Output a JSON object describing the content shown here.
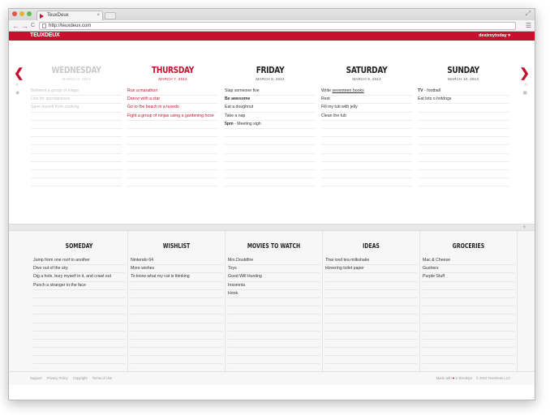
{
  "browser": {
    "tab_title": "TeuxDeux",
    "url": "http://teuxdeux.com",
    "tab_close": "×",
    "back": "←",
    "forward": "→",
    "reload": "C",
    "menu": "☰",
    "expand": "⤢"
  },
  "header": {
    "logo": "TEUXDEUX",
    "user": "destroytoday ▾"
  },
  "week": {
    "prev_arrow": "❮",
    "next_arrow": "❯",
    "days": [
      {
        "name": "WEDNESDAY",
        "date": "MARCH 6, 2013",
        "tasks": [
          "Befriend a group of ninjas",
          "Live for spontaneous",
          "Save myself from choking",
          "",
          "",
          "",
          "",
          "",
          "",
          "",
          "",
          ""
        ]
      },
      {
        "name": "THURSDAY",
        "date": "MARCH 7, 2013",
        "tasks": [
          "Run a marathon",
          "Dance with a star",
          "Go to the beach in a tuxedo",
          "Fight a group of ninjas using a gardening hose",
          "",
          "",
          "",
          "",
          "",
          "",
          "",
          ""
        ]
      },
      {
        "name": "FRIDAY",
        "date": "MARCH 8, 2013",
        "tasks": [
          "Slap someone five",
          "Be awesome",
          "Eat a doughnut",
          "Take a nap",
          "5pm - Meeting sigh",
          "",
          "",
          "",
          "",
          "",
          "",
          ""
        ]
      },
      {
        "name": "SATURDAY",
        "date": "MARCH 9, 2013",
        "tasks": [
          "Write seventeen books",
          "Rest",
          "Fill my tub with jelly",
          "Clean the tub",
          "",
          "",
          "",
          "",
          "",
          "",
          "",
          ""
        ]
      },
      {
        "name": "SUNDAY",
        "date": "MARCH 10, 2013",
        "tasks": [
          "TV - football",
          "Eat lots o hotdogs",
          "",
          "",
          "",
          "",
          "",
          "",
          "",
          "",
          "",
          ""
        ]
      }
    ]
  },
  "lists": [
    {
      "title": "SOMEDAY",
      "items": [
        "Jump from one roof to another",
        "Dive out of the sky",
        "Dig a hole, bury myself in it, and crawl out",
        "Punch a stranger in the face",
        "",
        "",
        "",
        "",
        "",
        "",
        "",
        "",
        "",
        ""
      ]
    },
    {
      "title": "WISHLIST",
      "items": [
        "Nintendo 64",
        "More wishes",
        "To know what my cat is thinking",
        "",
        "",
        "",
        "",
        "",
        "",
        "",
        "",
        "",
        "",
        ""
      ]
    },
    {
      "title": "MOVIES TO WATCH",
      "items": [
        "Mrs.Doubtfire",
        "Toys",
        "Good Will Hunting",
        "Insomnia",
        "Hook",
        "",
        "",
        "",
        "",
        "",
        "",
        "",
        "",
        ""
      ]
    },
    {
      "title": "IDEAS",
      "items": [
        "Thai iced tea milkshake",
        "Hovering toilet paper",
        "",
        "",
        "",
        "",
        "",
        "",
        "",
        "",
        "",
        "",
        "",
        ""
      ]
    },
    {
      "title": "GROCERIES",
      "items": [
        "Mac & Cheese",
        "Gushers",
        "Purple Stuff",
        "",
        "",
        "",
        "",
        "",
        "",
        "",
        "",
        "",
        "",
        ""
      ]
    }
  ],
  "footer": {
    "links": [
      "Support",
      "Privacy Policy",
      "Copyright",
      "Terms of Use"
    ],
    "made_prefix": "Made with",
    "heart": "♥",
    "made_suffix": "in Brooklyn",
    "copyright": "© 2013 TeuxDeux LLC"
  },
  "divider_plus": "+"
}
